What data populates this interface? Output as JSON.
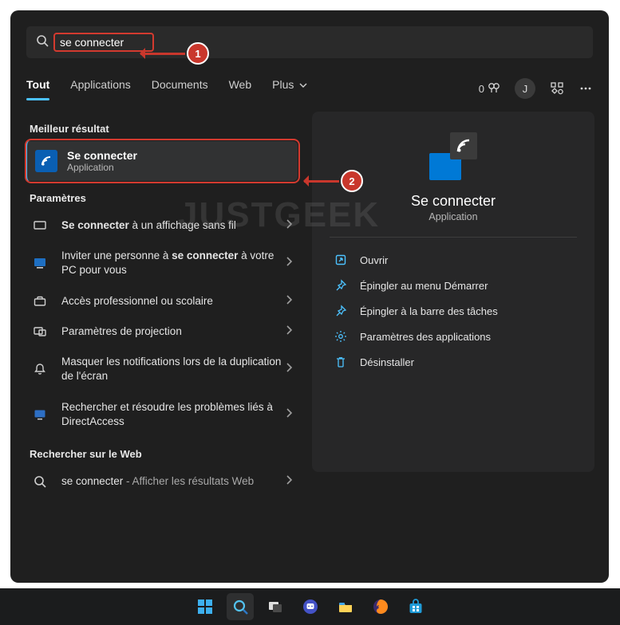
{
  "watermark": "JUSTGEEK",
  "search": {
    "value": "se connecter"
  },
  "tabs": {
    "all": "Tout",
    "apps": "Applications",
    "docs": "Documents",
    "web": "Web",
    "more": "Plus"
  },
  "tools": {
    "rewards_count": "0",
    "avatar_letter": "J"
  },
  "sections": {
    "best": "Meilleur résultat",
    "settings": "Paramètres",
    "web": "Rechercher sur le Web"
  },
  "best_result": {
    "title": "Se connecter",
    "subtitle": "Application"
  },
  "settings_items": [
    {
      "html": "<b>Se connecter</b> à un affichage sans fil"
    },
    {
      "html": "Inviter une personne à <b>se connecter</b> à votre PC pour vous"
    },
    {
      "html": "Accès professionnel ou scolaire"
    },
    {
      "html": "Paramètres de projection"
    },
    {
      "html": "Masquer les notifications lors de la duplication de l'écran"
    },
    {
      "html": "Rechercher et résoudre les problèmes liés à DirectAccess"
    }
  ],
  "web_item": {
    "term": "se connecter",
    "suffix": " - Afficher les résultats Web"
  },
  "preview": {
    "title": "Se connecter",
    "subtitle": "Application",
    "actions": {
      "open": "Ouvrir",
      "pin_start": "Épingler au menu Démarrer",
      "pin_taskbar": "Épingler à la barre des tâches",
      "settings": "Paramètres des applications",
      "uninstall": "Désinstaller"
    }
  },
  "annotations": {
    "step1": "1",
    "step2": "2"
  }
}
